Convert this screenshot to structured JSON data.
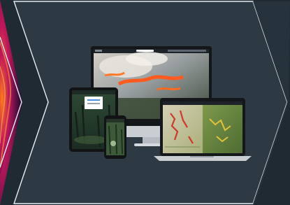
{
  "scene": {
    "colors": {
      "background": "#1f2a33",
      "panel": "#2d3a44",
      "outline": "#e6edf2",
      "heat_dark": "#4a0d3a",
      "heat_mid": "#c2185b",
      "heat_hot": "#ff7a1a",
      "fire": "#ff5a1f",
      "forest": "#2f4a2a",
      "map_green": "#6f8f4a",
      "device_dark": "#1a1c1f",
      "device_silver": "#c9ced3"
    }
  }
}
